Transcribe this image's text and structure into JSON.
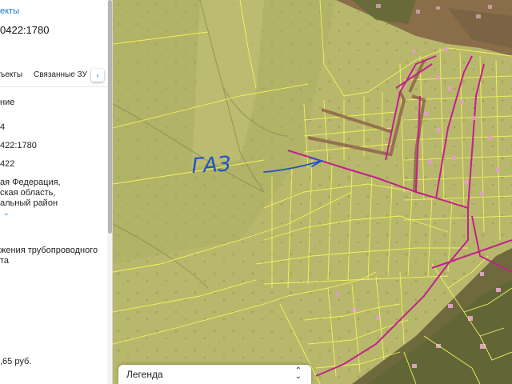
{
  "sidebar": {
    "back_link": "екты",
    "title": "0422:1780",
    "tabs": [
      {
        "label": "ъекты"
      },
      {
        "label": "Связанные ЗУ"
      }
    ],
    "tab_scroll_icon": "chevron-right-icon",
    "fields": [
      {
        "text": "ние"
      },
      {
        "text": "4"
      },
      {
        "text": "422:1780"
      },
      {
        "text": "422"
      },
      {
        "text": "ая Федерация,"
      },
      {
        "text": "ская область,"
      },
      {
        "text": "альный район"
      },
      {
        "text": "жения трубопроводного"
      },
      {
        "text": "та"
      },
      {
        "text": ",65 руб."
      }
    ],
    "expand_icon": "chevron-down-icon"
  },
  "map": {
    "handwritten_annotation": "ГАЗ",
    "legend": {
      "label": "Легенда",
      "toggle_icon": "up-down-arrows-icon"
    },
    "colors": {
      "parcel_fill": "#c8c878",
      "parcel_border": "#f0f060",
      "pipeline": "#c0208c",
      "annotation_ink": "#1f55c8"
    }
  }
}
